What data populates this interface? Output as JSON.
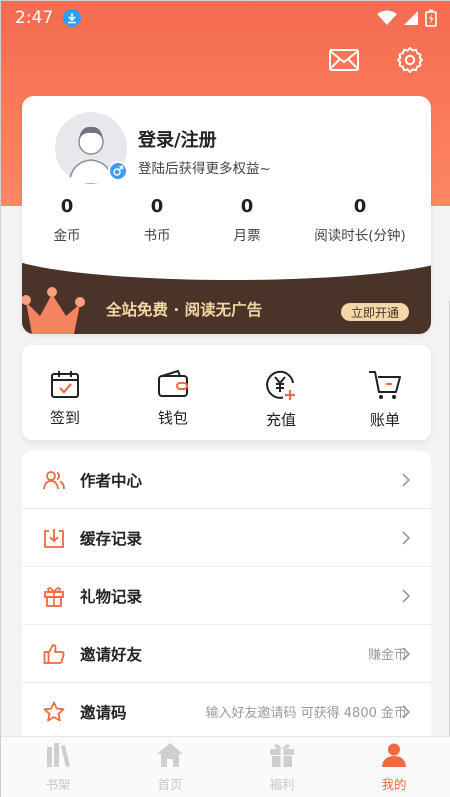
{
  "status_bar": {
    "time": "2:47"
  },
  "profile": {
    "title": "登录/注册",
    "subtitle": "登陆后获得更多权益~",
    "stats": [
      {
        "value": "0",
        "label": "金币"
      },
      {
        "value": "0",
        "label": "书币"
      },
      {
        "value": "0",
        "label": "月票"
      },
      {
        "value": "0",
        "label": "阅读时长(分钟)"
      }
    ]
  },
  "vip": {
    "text": "全站免费 · 阅读无广告",
    "button": "立即开通"
  },
  "quick_actions": [
    {
      "label": "签到",
      "icon": "calendar-check-icon"
    },
    {
      "label": "钱包",
      "icon": "wallet-icon"
    },
    {
      "label": "充值",
      "icon": "yen-plus-icon"
    },
    {
      "label": "账单",
      "icon": "cart-icon"
    }
  ],
  "menu": [
    {
      "label": "作者中心",
      "right": "",
      "icon": "author-icon"
    },
    {
      "label": "缓存记录",
      "right": "",
      "icon": "download-icon"
    },
    {
      "label": "礼物记录",
      "right": "",
      "icon": "gift-icon"
    },
    {
      "label": "邀请好友",
      "right": "赚金币",
      "icon": "thumbs-up-icon"
    },
    {
      "label": "邀请码",
      "right": "输入好友邀请码 可获得 4800 金币",
      "icon": "star-icon"
    }
  ],
  "tabs": [
    {
      "label": "书架",
      "icon": "bookshelf-icon",
      "active": false
    },
    {
      "label": "首页",
      "icon": "home-icon",
      "active": false
    },
    {
      "label": "福利",
      "icon": "gift-box-icon",
      "active": false
    },
    {
      "label": "我的",
      "icon": "person-icon",
      "active": true
    }
  ],
  "colors": {
    "accent": "#f06a40",
    "header_top": "#f56b4f",
    "vip_bg": "#4a3328",
    "vip_gold": "#f2d8a8"
  }
}
